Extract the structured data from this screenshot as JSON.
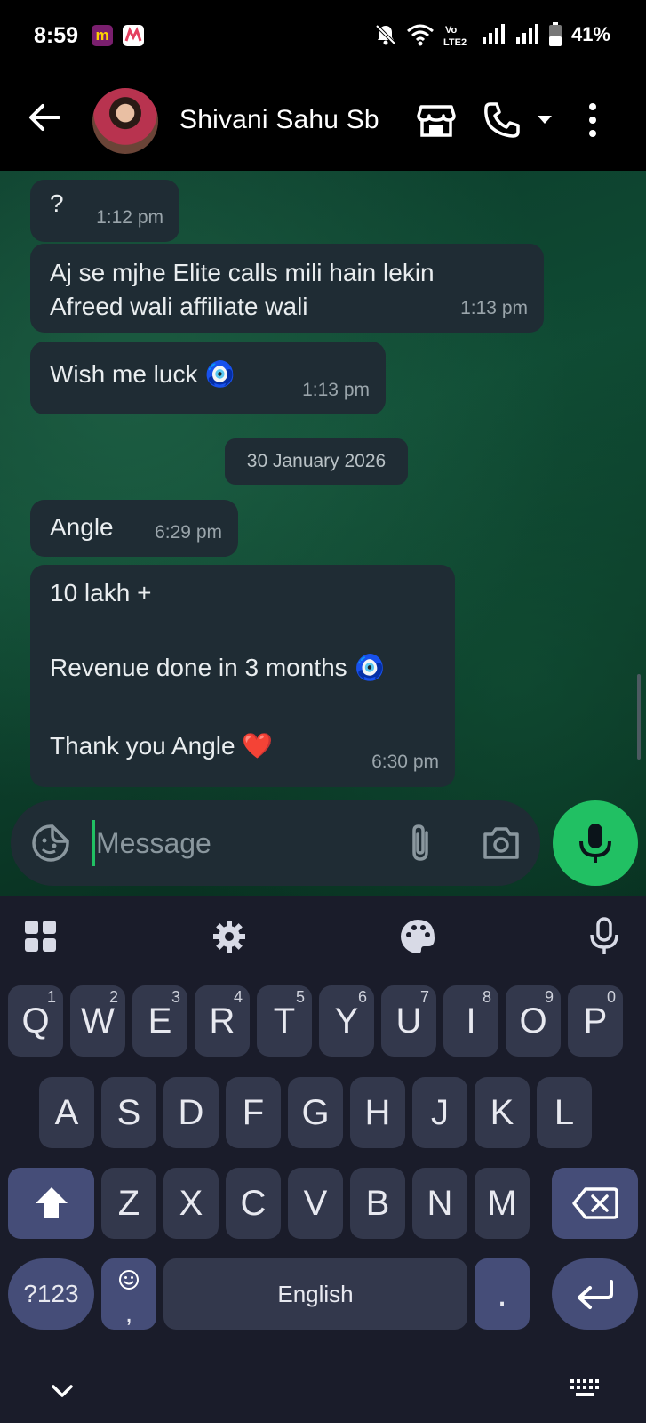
{
  "status_bar": {
    "time": "8:59",
    "app_icon_1": "m",
    "battery": "41%",
    "icons": [
      "mute-icon",
      "wifi-icon",
      "volte-icon",
      "signal-icon",
      "signal-icon",
      "battery-icon"
    ]
  },
  "header": {
    "contact_name": "Shivani Sahu Sb"
  },
  "messages": [
    {
      "text": "?",
      "time": "1:12 pm"
    },
    {
      "text": "Aj se mjhe Elite calls mili hain lekin Afreed wali affiliate wali",
      "time": "1:13 pm"
    },
    {
      "text": "Wish me luck 🧿",
      "time": "1:13 pm"
    },
    {
      "date": "30 January 2026"
    },
    {
      "text": "Angle",
      "time": "6:29 pm"
    },
    {
      "lines": [
        "10 lakh +",
        "Revenue done in 3 months 🧿",
        "Thank you Angle ❤️"
      ],
      "time": "6:30 pm"
    }
  ],
  "composer": {
    "placeholder": "Message"
  },
  "keyboard": {
    "language": "English",
    "symbols_key": "?123",
    "period_key": ".",
    "comma_key": ",",
    "row1": [
      {
        "k": "Q",
        "h": "1"
      },
      {
        "k": "W",
        "h": "2"
      },
      {
        "k": "E",
        "h": "3"
      },
      {
        "k": "R",
        "h": "4"
      },
      {
        "k": "T",
        "h": "5"
      },
      {
        "k": "Y",
        "h": "6"
      },
      {
        "k": "U",
        "h": "7"
      },
      {
        "k": "I",
        "h": "8"
      },
      {
        "k": "O",
        "h": "9"
      },
      {
        "k": "P",
        "h": "0"
      }
    ],
    "row2": [
      "A",
      "S",
      "D",
      "F",
      "G",
      "H",
      "J",
      "K",
      "L"
    ],
    "row3": [
      "Z",
      "X",
      "C",
      "V",
      "B",
      "N",
      "M"
    ]
  },
  "colors": {
    "accent_green": "#21c063",
    "bubble": "#1f2c34",
    "keyboard_bg": "#1a1c2a",
    "key_bg": "#33384c",
    "mod_key_bg": "#454d78"
  }
}
